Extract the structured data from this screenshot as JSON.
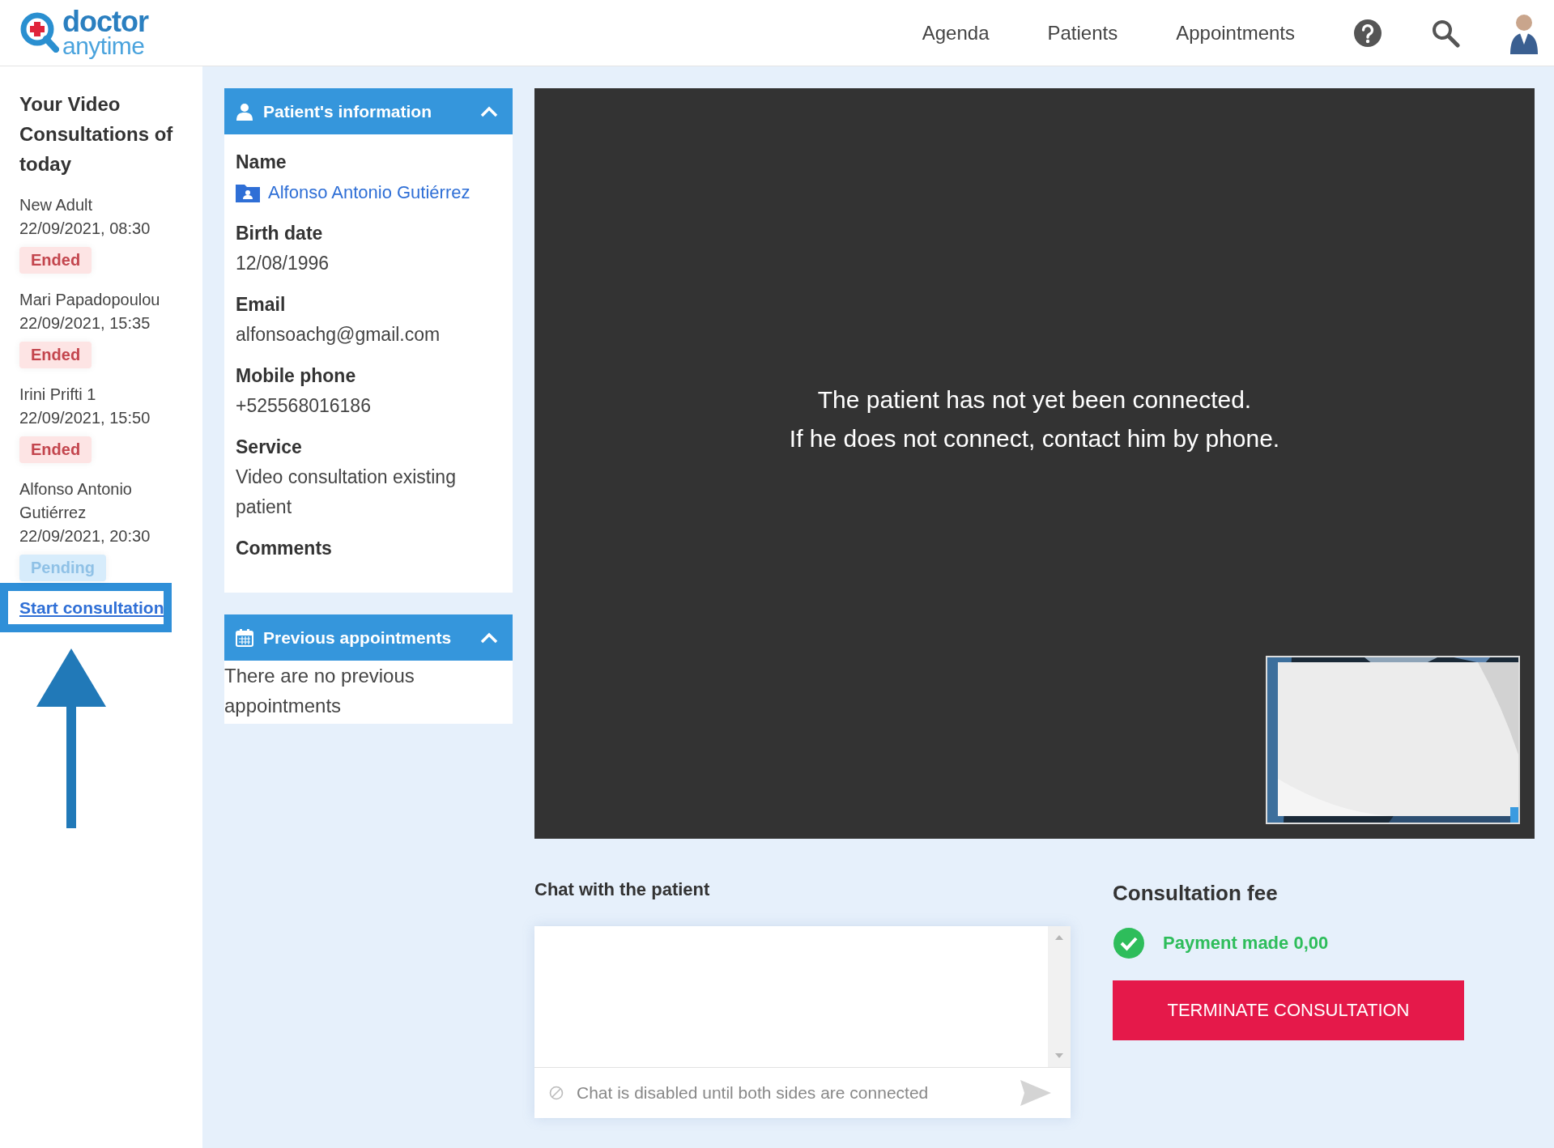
{
  "header": {
    "logo": {
      "line_1": "doctor",
      "line_2": "anytime"
    },
    "nav": [
      "Agenda",
      "Patients",
      "Appointments"
    ]
  },
  "sidebar": {
    "title": "Your Video Consultations of today",
    "consultations": [
      {
        "name": "New Adult",
        "datetime": "22/09/2021, 08:30",
        "status": "Ended",
        "kind": "ended"
      },
      {
        "name": "Mari Papadopoulou",
        "datetime": "22/09/2021, 15:35",
        "status": "Ended",
        "kind": "ended"
      },
      {
        "name": "Irini Prifti 1",
        "datetime": "22/09/2021, 15:50",
        "status": "Ended",
        "kind": "ended"
      },
      {
        "name": "Alfonso Antonio Gutiérrez",
        "datetime": "22/09/2021, 20:30",
        "status": "Pending",
        "kind": "pending"
      }
    ],
    "start_link": "Start consultation"
  },
  "patient_info": {
    "title": "Patient's information",
    "expanded": true,
    "fields": [
      {
        "label": "Name",
        "value": "Alfonso Antonio Gutiérrez",
        "kind": "link"
      },
      {
        "label": "Birth date",
        "value": "12/08/1996",
        "kind": "text"
      },
      {
        "label": "Email",
        "value": "alfonsoachg@gmail.com",
        "kind": "text"
      },
      {
        "label": "Mobile phone",
        "value": "+525568016186",
        "kind": "text"
      },
      {
        "label": "Service",
        "value": "Video consultation existing patient",
        "kind": "text"
      },
      {
        "label": "Comments",
        "kind": "text"
      }
    ]
  },
  "previous_appointments": {
    "title": "Previous appointments",
    "expanded": true,
    "empty_text": "There are no previous appointments"
  },
  "video": {
    "message_line_1": "The patient has not yet been connected.",
    "message_line_2": "If he does not connect, contact him by phone."
  },
  "chat": {
    "title": "Chat with the patient",
    "placeholder": "Chat is disabled until both sides are connected",
    "disabled": true
  },
  "fee": {
    "title": "Consultation fee",
    "payment": "Payment made 0,00",
    "paid": true,
    "button": "TERMINATE CONSULTATION"
  }
}
